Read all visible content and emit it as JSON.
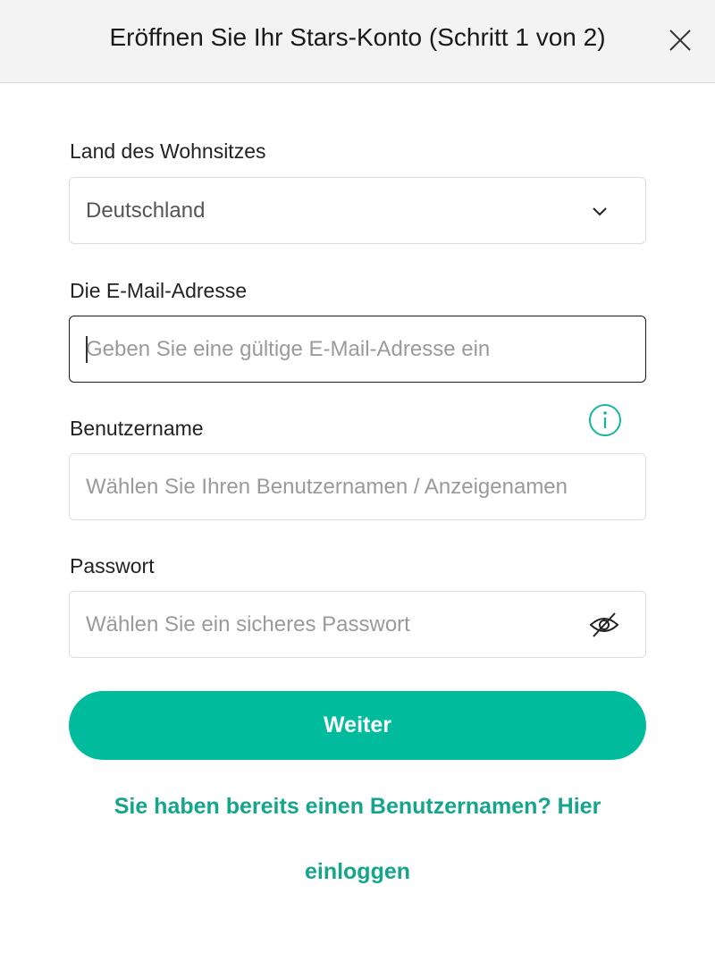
{
  "header": {
    "title": "Eröffnen Sie Ihr Stars-Konto (Schritt 1 von 2)",
    "close_icon": "close-icon"
  },
  "form": {
    "country": {
      "label": "Land des Wohnsitzes",
      "value": "Deutschland",
      "icon": "chevron-down-icon"
    },
    "email": {
      "label": "Die E-Mail-Adresse",
      "value": "",
      "placeholder": "Geben Sie eine gültige E-Mail-Adresse ein"
    },
    "username": {
      "label": "Benutzername",
      "value": "",
      "placeholder": "Wählen Sie Ihren Benutzernamen / Anzeigenamen",
      "info_icon": "info-icon"
    },
    "password": {
      "label": "Passwort",
      "value": "",
      "placeholder": "Wählen Sie ein sicheres Passwort",
      "icon": "eye-off-icon"
    },
    "submit_label": "Weiter",
    "login_prompt_line1": "Sie haben bereits einen Benutzernamen? Hier",
    "login_prompt_line2": "einloggen"
  },
  "colors": {
    "accent": "#00bb9c",
    "link": "#14a58b",
    "header_bg": "#f3f3f3",
    "border": "#dedede"
  }
}
